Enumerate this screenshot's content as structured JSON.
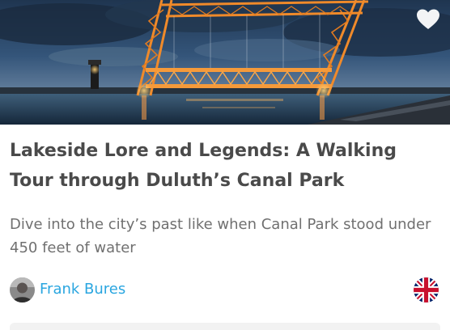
{
  "tour": {
    "title": "Lakeside Lore and Legends: A Walking Tour through Duluth’s Canal Park",
    "description": "Dive into the city’s past like when Canal Park stood under 450 feet of water",
    "author": {
      "name": "Frank Bures"
    },
    "language_flag": "uk-flag-icon",
    "favorite_icon": "heart-icon"
  },
  "colors": {
    "title": "#4a4a4a",
    "description": "#707070",
    "author_link": "#2aa6e0",
    "bridge": "#f08a2a",
    "sky": "#2c4a6e"
  }
}
